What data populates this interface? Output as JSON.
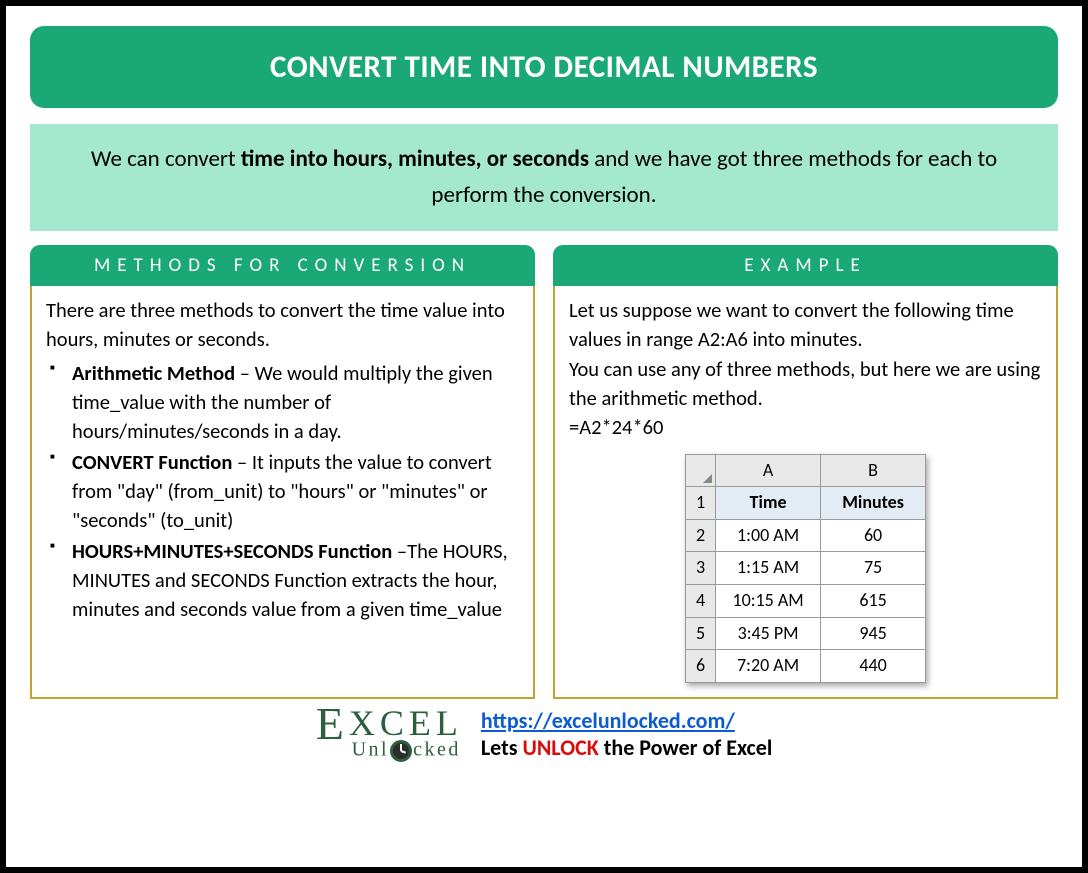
{
  "title": "CONVERT TIME INTO DECIMAL NUMBERS",
  "intro": {
    "pre": "We can convert ",
    "bold": "time into hours, minutes, or seconds",
    "post": " and we have got three methods for each to perform the conversion."
  },
  "left": {
    "header": "METHODS FOR CONVERSION",
    "lead": "There are three methods to convert the time value into hours, minutes or seconds.",
    "items": [
      {
        "title": "Arithmetic Method",
        "sep": " – ",
        "desc": "We would multiply the given time_value with the number of hours/minutes/seconds in a day."
      },
      {
        "title": "CONVERT Function",
        "sep": " – ",
        "desc": "It inputs the value to convert from \"day\" (from_unit) to \"hours\" or \"minutes\" or \"seconds\" (to_unit)"
      },
      {
        "title": "HOURS+MINUTES+SECONDS Function",
        "sep": " –",
        "desc": "The HOURS, MINUTES and SECONDS Function extracts the hour, minutes and seconds value from a given time_value"
      }
    ]
  },
  "right": {
    "header": "EXAMPLE",
    "p1": "Let us suppose we want to convert the following time values in range A2:A6 into minutes.",
    "p2": "You can use any of three methods, but here we are using the arithmetic method.",
    "formula": "=A2*24*60",
    "table": {
      "cols": [
        "A",
        "B"
      ],
      "headers": [
        "Time",
        "Minutes"
      ],
      "rows": [
        [
          "1:00 AM",
          "60"
        ],
        [
          "1:15 AM",
          "75"
        ],
        [
          "10:15 AM",
          "615"
        ],
        [
          "3:45 PM",
          "945"
        ],
        [
          "7:20 AM",
          "440"
        ]
      ]
    }
  },
  "footer": {
    "logo_l1a": "E",
    "logo_l1b": "XCEL",
    "logo_l2": "Unl   cked",
    "url": "https://excelunlocked.com/",
    "tagline_pre": "Lets ",
    "tagline_unlock": "UNLOCK",
    "tagline_post": " the Power of Excel"
  }
}
